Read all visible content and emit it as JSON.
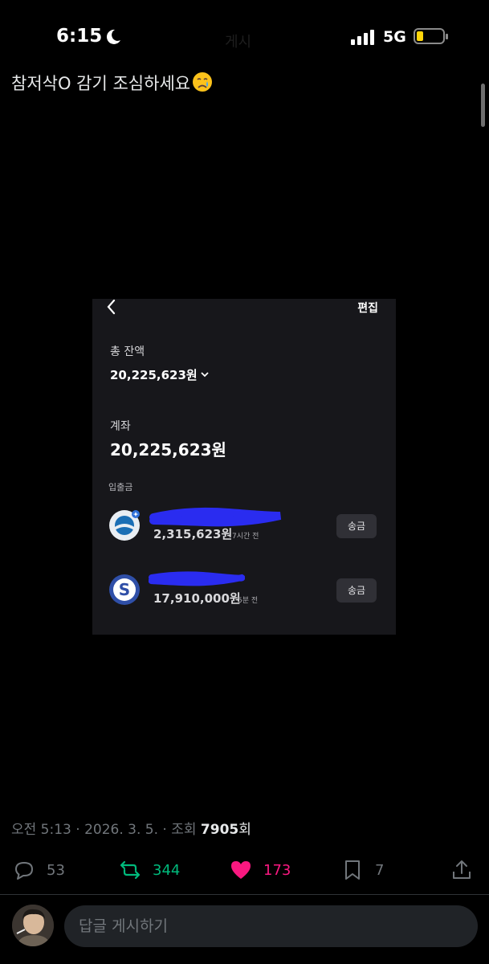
{
  "status_bar": {
    "time": "6:15",
    "network": "5G",
    "ghost_title": "게시"
  },
  "post": {
    "text": "참저삭O 감기 조심하세요",
    "emoji": "crying-face-emoji"
  },
  "embedded_screenshot": {
    "edit_label": "편집",
    "total_label": "총 잔액",
    "total_amount": "20,225,623원",
    "account_label": "계좌",
    "account_amount": "20,225,623원",
    "section_label": "입출금",
    "accounts": [
      {
        "balance": "2,315,623원",
        "time": "7시간 전",
        "send_label": "송금"
      },
      {
        "balance": "17,910,000원",
        "time": "5분 전",
        "send_label": "송금"
      }
    ]
  },
  "meta": {
    "time": "오전 5:13",
    "separator": " · ",
    "date": "2026. 3. 5.",
    "views_prefix": "조회",
    "views": "7905",
    "views_suffix": "회"
  },
  "actions": {
    "replies": "53",
    "retweets": "344",
    "likes": "173",
    "bookmarks": "7"
  },
  "reply_box": {
    "placeholder": "답글 게시하기"
  },
  "colors": {
    "background": "#000000",
    "retweet": "#00ba7c",
    "like": "#f91880",
    "muted": "#71767b",
    "scribble": "#2a2cf0"
  }
}
